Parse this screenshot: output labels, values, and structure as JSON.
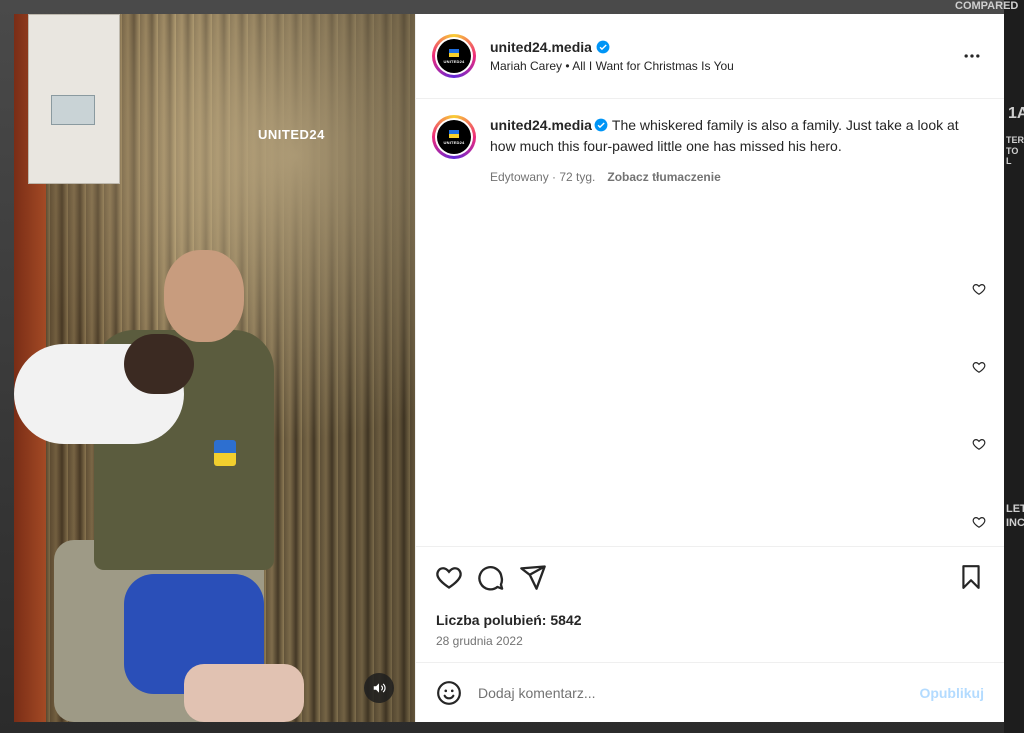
{
  "background": {
    "top_right_text": "COMPARED",
    "side_text_1": "1A",
    "side_text_2": "TER",
    "side_text_3": "TO L",
    "side_text_4": "LET",
    "side_text_5": "INC"
  },
  "post": {
    "username": "united24.media",
    "music": "Mariah Carey • All I Want for Christmas Is You",
    "avatar_text": "UNITED24",
    "watermark": "UNITED24",
    "caption_username": "united24.media",
    "caption_text": "The whiskered family is also a family. Just take a look at how much this four-pawed little one has missed his hero.",
    "edited_label": "Edytowany · 72 tyg.",
    "translate_label": "Zobacz tłumaczenie",
    "likes_label": "Liczba polubień: 5842",
    "date": "28 grudnia 2022"
  },
  "comment": {
    "placeholder": "Dodaj komentarz...",
    "post_label": "Opublikuj"
  },
  "colors": {
    "verified": "#0095f6",
    "text": "#262626",
    "secondary": "#737373",
    "post_disabled": "#b3dbff"
  },
  "icons": [
    "verified-icon",
    "more-icon",
    "heart-icon",
    "comment-icon",
    "share-icon",
    "bookmark-icon",
    "emoji-icon",
    "sound-icon"
  ]
}
